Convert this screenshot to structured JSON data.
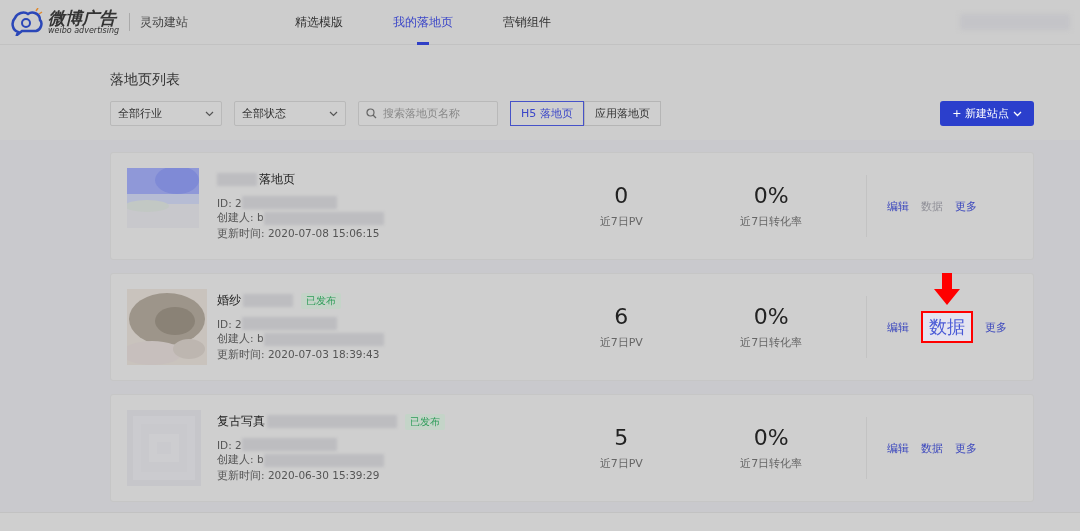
{
  "header": {
    "logo_title": "微博广告",
    "logo_subtitle": "weibo advertising",
    "product": "灵动建站",
    "nav": [
      {
        "label": "精选模版",
        "selected": false
      },
      {
        "label": "我的落地页",
        "selected": true
      },
      {
        "label": "营销组件",
        "selected": false
      }
    ]
  },
  "page_title": "落地页列表",
  "filters": {
    "dropdowns": [
      "全部行业",
      "全部状态"
    ],
    "search": {
      "placeholder": "搜索落地页名称"
    },
    "segments": [
      {
        "label": "H5 落地页",
        "selected": true
      },
      {
        "label": "应用落地页",
        "selected": false
      }
    ],
    "new_button": "+ 新建站点"
  },
  "cards": [
    {
      "title_prefix_redacted": true,
      "title": "落地页",
      "id": "ID: 2",
      "creator": "创建人: b",
      "updated": "更新时间: 2020-07-08 15:06:15",
      "pv": "0",
      "pv_label": "近7日PV",
      "rate": "0%",
      "rate_label": "近7日转化率",
      "actions": [
        {
          "label": "编辑",
          "disabled": false,
          "highlighted": false
        },
        {
          "label": "数据",
          "disabled": true,
          "highlighted": false
        },
        {
          "label": "更多",
          "disabled": false,
          "highlighted": false
        }
      ]
    },
    {
      "title_prefix_redacted": false,
      "title": "婚纱",
      "badge": "已发布",
      "id": "ID: 2",
      "creator": "创建人: b",
      "updated": "更新时间: 2020-07-03 18:39:43",
      "pv": "6",
      "pv_label": "近7日PV",
      "rate": "0%",
      "rate_label": "近7日转化率",
      "actions": [
        {
          "label": "编辑",
          "disabled": false,
          "highlighted": false
        },
        {
          "label": "数据",
          "disabled": false,
          "highlighted": true
        },
        {
          "label": "更多",
          "disabled": false,
          "highlighted": false
        }
      ]
    },
    {
      "title_prefix_redacted": false,
      "title": "复古写真",
      "badge": "已发布",
      "id": "ID: 2",
      "creator": "创建人: b",
      "updated": "更新时间: 2020-06-30 15:39:29",
      "pv": "5",
      "pv_label": "近7日PV",
      "rate": "0%",
      "rate_label": "近7日转化率",
      "actions": [
        {
          "label": "编辑",
          "disabled": false,
          "highlighted": false
        },
        {
          "label": "数据",
          "disabled": false,
          "highlighted": false
        },
        {
          "label": "更多",
          "disabled": false,
          "highlighted": false
        }
      ]
    }
  ]
}
